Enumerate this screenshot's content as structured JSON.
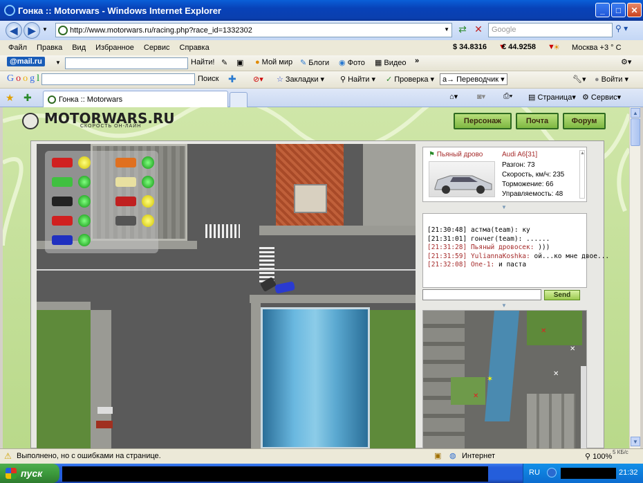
{
  "window": {
    "title": "Гонка :: Motorwars - Windows Internet Explorer"
  },
  "browser": {
    "url": "http://www.motorwars.ru/racing.php?race_id=1332302",
    "search_placeholder": "Google",
    "menu": [
      "Файл",
      "Правка",
      "Вид",
      "Избранное",
      "Сервис",
      "Справка"
    ],
    "mailru": {
      "logo": "@mail.ru",
      "find": "Найти!",
      "items": [
        "Мой мир",
        "Блоги",
        "Фото",
        "Видео"
      ],
      "usd": "$ 34.8316",
      "eur": "€ 44.9258",
      "weather": "Москва +3 ° C"
    },
    "google": {
      "logo": "Google",
      "search": "Поиск",
      "bookmarks": "Закладки",
      "find": "Найти",
      "check": "Проверка",
      "translate": "Переводчик",
      "login": "Войти"
    },
    "tab": {
      "title": "Гонка :: Motorwars"
    },
    "cmdbar": {
      "page": "Страница",
      "service": "Сервис"
    }
  },
  "site": {
    "logo": "MOTORWARS.RU",
    "tagline": "СКОРОСТЬ ОН-ЛАЙН",
    "nav": [
      "Персонаж",
      "Почта",
      "Форум"
    ]
  },
  "racer": {
    "name": "Пьяный дрово",
    "car": "Audi A6[31]",
    "stats": [
      "Разгон: 73",
      "Скорость, км/ч: 235",
      "Торможение: 66",
      "Управляемость: 48"
    ]
  },
  "chat": {
    "lines": [
      {
        "time": "[21:30:48]",
        "nick": "астма(team):",
        "msg": "ку"
      },
      {
        "time": "[21:31:01]",
        "nick": "гончег(team):",
        "msg": "......"
      },
      {
        "time": "[21:31:28]",
        "nick": "Пьяный дровосек:",
        "msg": ")))"
      },
      {
        "time": "[21:31:59]",
        "nick": "YuliannaKoshka:",
        "msg": "ой...ко мне двое..."
      },
      {
        "time": "[21:32:08]",
        "nick": "One-1:",
        "msg": "и паста"
      }
    ],
    "send": "Send"
  },
  "colors": {
    "accent": "#7fb842",
    "chat_nick": "#a52a2a"
  },
  "status": {
    "text": "Выполнено, но с ошибками на странице.",
    "zone": "Интернет",
    "zoom": "100%",
    "speed": "5 КБ/с"
  },
  "taskbar": {
    "start": "пуск",
    "lang": "RU",
    "time": "21:32"
  }
}
